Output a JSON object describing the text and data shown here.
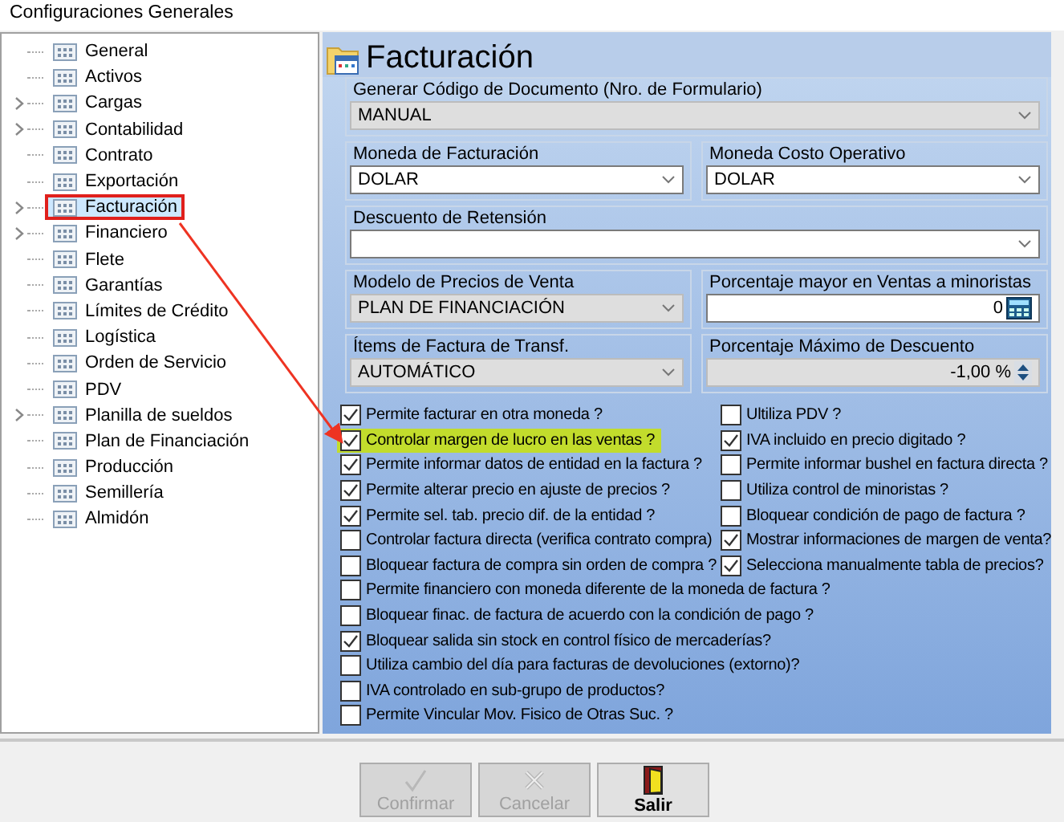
{
  "window": {
    "title": "Configuraciones Generales"
  },
  "tree": [
    {
      "label": "General",
      "expandable": false,
      "selected": false
    },
    {
      "label": "Activos",
      "expandable": false,
      "selected": false
    },
    {
      "label": "Cargas",
      "expandable": true,
      "selected": false
    },
    {
      "label": "Contabilidad",
      "expandable": true,
      "selected": false
    },
    {
      "label": "Contrato",
      "expandable": false,
      "selected": false
    },
    {
      "label": "Exportación",
      "expandable": false,
      "selected": false
    },
    {
      "label": "Facturación",
      "expandable": true,
      "selected": true
    },
    {
      "label": "Financiero",
      "expandable": true,
      "selected": false
    },
    {
      "label": "Flete",
      "expandable": false,
      "selected": false
    },
    {
      "label": "Garantías",
      "expandable": false,
      "selected": false
    },
    {
      "label": "Límites de Crédito",
      "expandable": false,
      "selected": false
    },
    {
      "label": "Logística",
      "expandable": false,
      "selected": false
    },
    {
      "label": "Orden de Servicio",
      "expandable": false,
      "selected": false
    },
    {
      "label": "PDV",
      "expandable": false,
      "selected": false
    },
    {
      "label": "Planilla de sueldos",
      "expandable": true,
      "selected": false
    },
    {
      "label": "Plan de Financiación",
      "expandable": false,
      "selected": false
    },
    {
      "label": "Producción",
      "expandable": false,
      "selected": false
    },
    {
      "label": "Semillería",
      "expandable": false,
      "selected": false
    },
    {
      "label": "Almidón",
      "expandable": false,
      "selected": false
    }
  ],
  "panel": {
    "title": "Facturación"
  },
  "field_rows": [
    [
      {
        "label": "Generar Código de Documento (Nro. de Formulario)",
        "kind": "dropdown",
        "value": "MANUAL",
        "disabled": true
      }
    ],
    [
      {
        "label": "Moneda de Facturación",
        "kind": "dropdown",
        "value": "DOLAR",
        "disabled": false
      },
      {
        "label": "Moneda Costo Operativo",
        "kind": "dropdown",
        "value": "DOLAR",
        "disabled": false
      }
    ],
    [
      {
        "label": "Descuento de Retensión",
        "kind": "dropdown",
        "disabled": false
      }
    ],
    [
      {
        "label": "Modelo de Precios de Venta",
        "kind": "dropdown",
        "value": "PLAN DE FINANCIACIÓN",
        "disabled": true
      },
      {
        "label": "Porcentaje mayor en Ventas a minoristas",
        "kind": "calculator",
        "value": "0",
        "disabled": false
      }
    ],
    [
      {
        "label": "Ítems de Factura de Transf.",
        "kind": "dropdown",
        "value": "AUTOMÁTICO",
        "disabled": true
      },
      {
        "label": "Porcentaje Máximo de Descuento",
        "kind": "spinner",
        "value": "-1,00 %",
        "disabled": true
      }
    ]
  ],
  "checkbox_rows": [
    [
      {
        "label": "Permite facturar en otra moneda ?",
        "checked": true,
        "highlighted": false
      },
      {
        "label": "Ultiliza PDV ?",
        "checked": false,
        "highlighted": false
      }
    ],
    [
      {
        "label": "Controlar margen de lucro en las ventas ?",
        "checked": true,
        "highlighted": true
      },
      {
        "label": "IVA incluido en precio digitado ?",
        "checked": true,
        "highlighted": false
      }
    ],
    [
      {
        "label": "Permite  informar datos de entidad en la factura ?",
        "checked": true,
        "highlighted": false
      },
      {
        "label": "Permite informar bushel en factura directa ?",
        "checked": false,
        "highlighted": false
      }
    ],
    [
      {
        "label": "Permite alterar precio en ajuste de precios ?",
        "checked": true,
        "highlighted": false
      },
      {
        "label": "Utiliza control de minoristas ?",
        "checked": false,
        "highlighted": false
      }
    ],
    [
      {
        "label": "Permite sel. tab. precio dif. de la entidad ?",
        "checked": true,
        "highlighted": false
      },
      {
        "label": "Bloquear condición de pago de factura ?",
        "checked": false,
        "highlighted": false
      }
    ],
    [
      {
        "label": "Controlar factura directa (verifica contrato compra)",
        "checked": false,
        "highlighted": false
      },
      {
        "label": "Mostrar informaciones de margen de venta?",
        "checked": true,
        "highlighted": false
      }
    ],
    [
      {
        "label": "Bloquear factura de compra sin orden de compra ?",
        "checked": false,
        "highlighted": false
      },
      {
        "label": "Selecciona manualmente tabla de precios?",
        "checked": true,
        "highlighted": false
      }
    ],
    [
      {
        "label": "Permite financiero con moneda diferente de la moneda de factura ?",
        "checked": false,
        "highlighted": false
      }
    ],
    [
      {
        "label": "Bloquear finac. de factura de acuerdo con la condición de pago ?",
        "checked": false,
        "highlighted": false
      }
    ],
    [
      {
        "label": "Bloquear salida sin stock en control físico de mercaderías?",
        "checked": true,
        "highlighted": false
      }
    ],
    [
      {
        "label": "Utiliza cambio del día para facturas de devoluciones (extorno)?",
        "checked": false,
        "highlighted": false
      }
    ],
    [
      {
        "label": "IVA controlado en sub-grupo de productos?",
        "checked": false,
        "highlighted": false
      }
    ],
    [
      {
        "label": "Permite Vincular Mov. Fisico de Otras Suc. ?",
        "checked": false,
        "highlighted": false
      }
    ]
  ],
  "buttons": [
    {
      "label": "Confirmar",
      "kind": "confirm",
      "disabled": true
    },
    {
      "label": "Cancelar",
      "kind": "cancel",
      "disabled": true
    },
    {
      "label": "Salir",
      "kind": "exit",
      "disabled": false
    }
  ]
}
